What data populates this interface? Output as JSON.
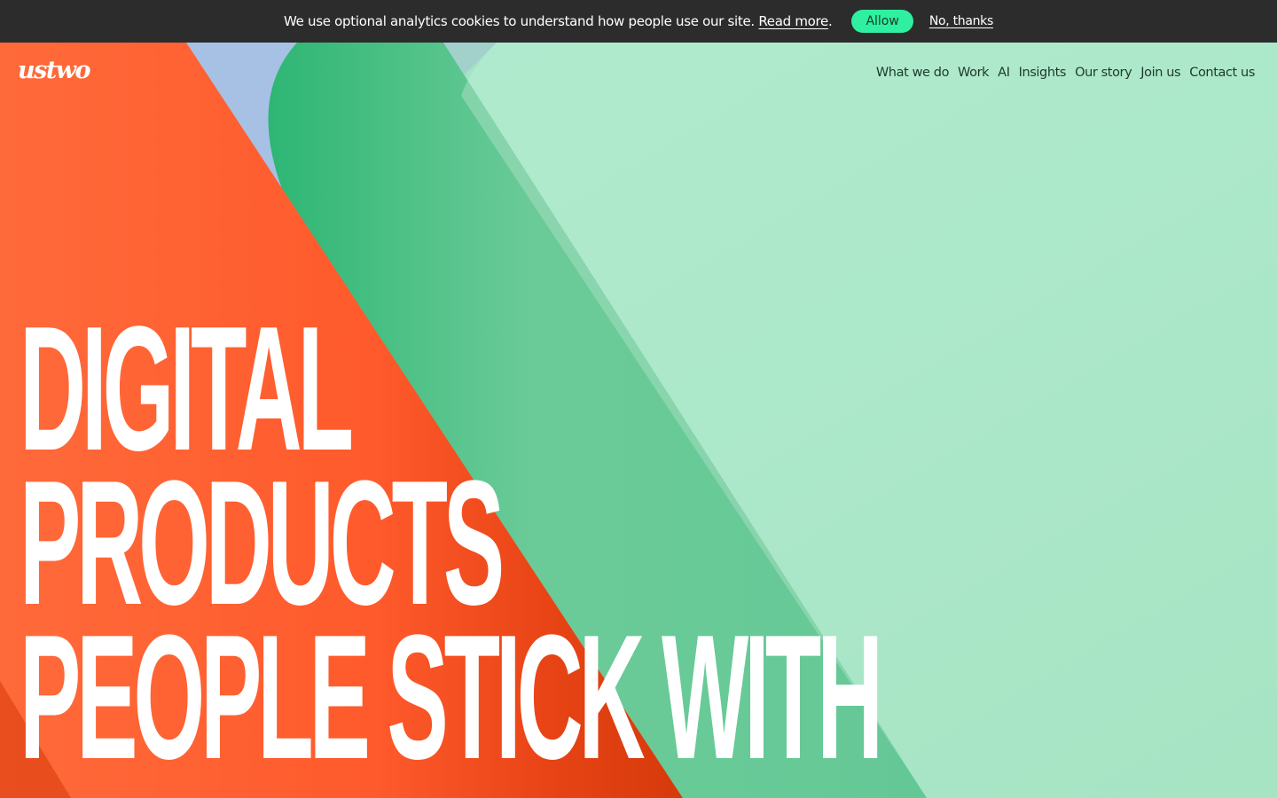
{
  "cookie_banner": {
    "message": "We use optional analytics cookies to understand how people use our site.",
    "read_more": "Read more",
    "period": ".",
    "allow_label": "Allow",
    "decline_label": "No, thanks",
    "background_color": "#2c2c2c",
    "allow_color": "#2ef0a0"
  },
  "brand": {
    "logo_text": "ustwo"
  },
  "nav": {
    "items": [
      "What we do",
      "Work",
      "AI",
      "Insights",
      "Our story",
      "Join us",
      "Contact us"
    ]
  },
  "hero": {
    "headline_lines": [
      "DIGITAL",
      "PRODUCTS",
      "PEOPLE STICK WITH"
    ],
    "colors": {
      "orange": "#ff5a2c",
      "green": "#64c896",
      "mint": "#a9e6c6",
      "blue": "#a7c1e4"
    }
  }
}
